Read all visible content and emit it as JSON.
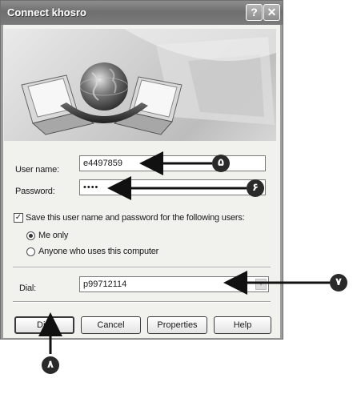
{
  "window": {
    "title": "Connect khosro"
  },
  "form": {
    "username_label": "User name:",
    "username_value": "e4497859",
    "password_label": "Password:",
    "password_value": "••••",
    "save_label": "Save this user name and password for the following users:",
    "save_checked": true,
    "radio_me_label": "Me only",
    "radio_anyone_label": "Anyone who uses this computer",
    "dial_label": "Dial:",
    "dial_value": "p99712114"
  },
  "buttons": {
    "dial": "Dial",
    "cancel": "Cancel",
    "properties": "Properties",
    "help": "Help"
  },
  "callouts": {
    "username": "۵",
    "password": "۶",
    "dial_field": "۷",
    "dial_button": "۸"
  },
  "icons": {
    "help": "?",
    "close": "✕",
    "check": "✓",
    "dropdown": "▾"
  }
}
